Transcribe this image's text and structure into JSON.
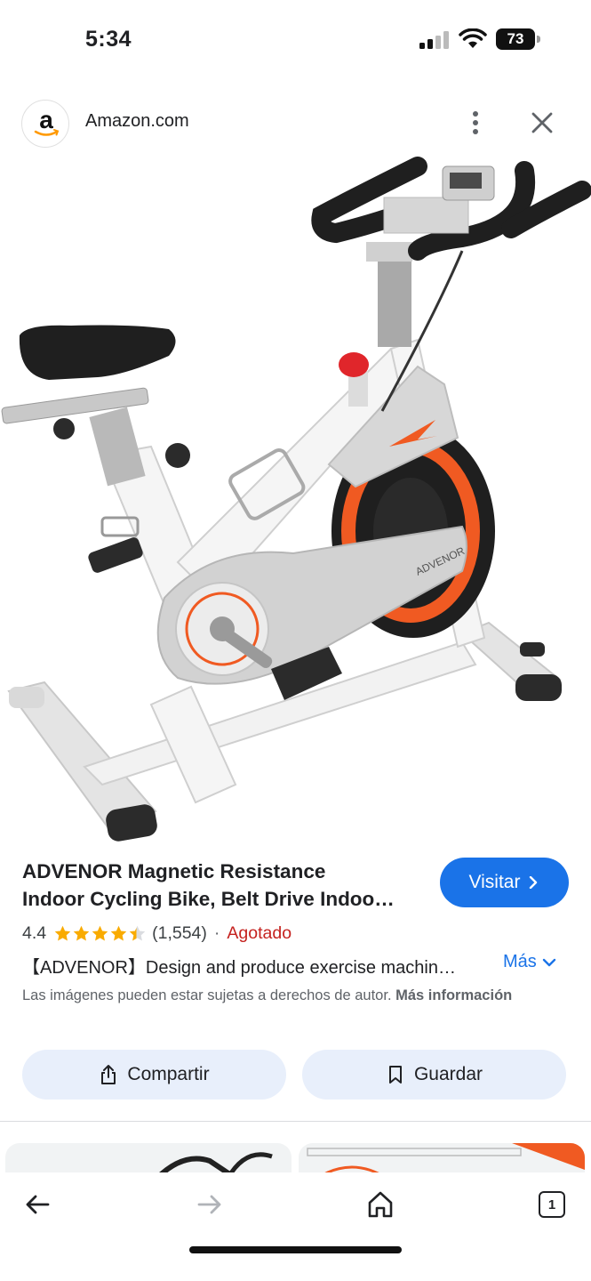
{
  "status_bar": {
    "time": "5:34",
    "battery": "73"
  },
  "header": {
    "site_name": "Amazon.com",
    "logo_letter": "a"
  },
  "product": {
    "title_line1": "ADVENOR Magnetic Resistance",
    "title_line2": "Indoor Cycling Bike, Belt Drive Indoo…",
    "rating": "4.4",
    "stars": 4.4,
    "review_count": "(1,554)",
    "separator": "·",
    "availability": "Agotado",
    "description": "【ADVENOR】Design and produce exercise machin…",
    "more_label": "Más"
  },
  "buttons": {
    "visit": "Visitar",
    "share": "Compartir",
    "save": "Guardar"
  },
  "copyright": {
    "text": "Las imágenes pueden estar sujetas a derechos de autor.",
    "link": "Más información"
  },
  "bottom_nav": {
    "tabs_count": "1"
  },
  "colors": {
    "accent": "#1a73e8",
    "sold_out": "#c5221f",
    "star": "#f9ab00",
    "action_bg": "#e8effb"
  }
}
